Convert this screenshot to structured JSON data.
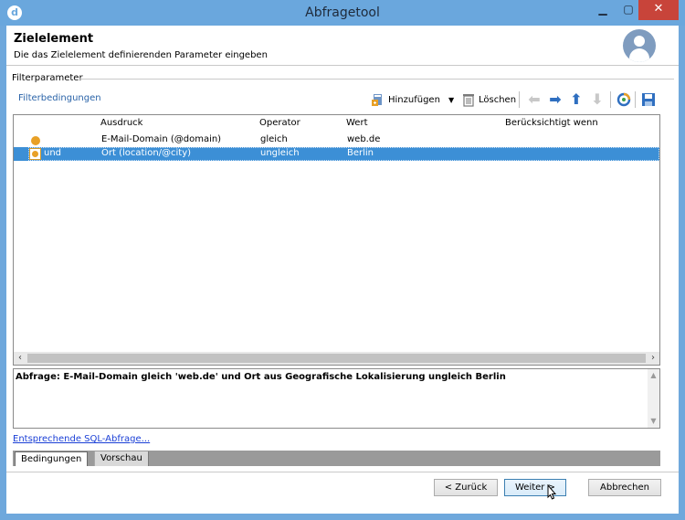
{
  "window": {
    "title": "Abfragetool",
    "app_icon": "d"
  },
  "header": {
    "title": "Zielelement",
    "subtitle": "Die das Zielelement definierenden Parameter eingeben"
  },
  "group": {
    "label": "Filterparameter"
  },
  "toolbar": {
    "caption": "Filterbedingungen",
    "add_label": "Hinzufügen",
    "delete_label": "Löschen",
    "icons": [
      "add-condition-icon",
      "dropdown-arrow-icon",
      "trash-icon",
      "arrow-left-icon",
      "arrow-right-icon",
      "arrow-up-icon",
      "arrow-down-icon",
      "refresh-icon",
      "save-icon"
    ]
  },
  "table": {
    "columns": [
      "Ausdruck",
      "Operator",
      "Wert",
      "Berücksichtigt wenn"
    ],
    "rows": [
      {
        "prefix": "",
        "expression": "E-Mail-Domain (@domain)",
        "operator": "gleich",
        "value": "web.de",
        "condition": "",
        "selected": false
      },
      {
        "prefix": "und",
        "expression": "Ort (location/@city)",
        "operator": "ungleich",
        "value": "Berlin",
        "condition": "",
        "selected": true
      }
    ]
  },
  "query": {
    "text": "Abfrage: E-Mail-Domain gleich 'web.de' und Ort aus Geografische Lokalisierung ungleich Berlin"
  },
  "sql_link": "Entsprechende SQL-Abfrage...",
  "tabs": [
    "Bedingungen",
    "Vorschau"
  ],
  "buttons": {
    "back": "< Zurück",
    "next": "Weiter >",
    "cancel": "Abbrechen"
  },
  "colors": {
    "titlebar": "#6aa7dd",
    "selection": "#3c8fd6",
    "link": "#1a3fd6",
    "close": "#c8443a"
  }
}
